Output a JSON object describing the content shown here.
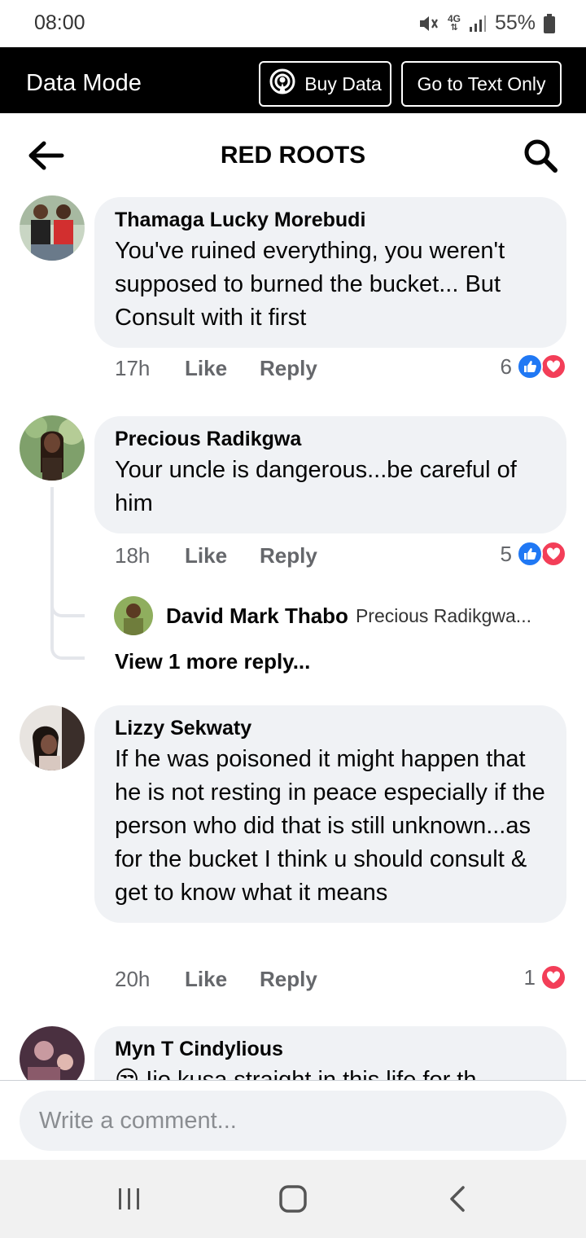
{
  "status_bar": {
    "time": "08:00",
    "network": "4G",
    "battery": "55%",
    "icons": [
      "mute-icon",
      "network-4g-icon",
      "signal-icon",
      "battery-icon"
    ]
  },
  "data_mode_bar": {
    "title": "Data Mode",
    "buy_data_label": "Buy Data",
    "text_only_label": "Go to Text Only"
  },
  "header": {
    "title": "RED ROOTS",
    "icons": [
      "back-arrow-icon",
      "search-icon"
    ]
  },
  "comments": [
    {
      "author": "Thamaga Lucky Morebudi",
      "text": "You've ruined everything, you weren't supposed to burned the bucket... But Consult with it first",
      "time": "17h",
      "like_label": "Like",
      "reply_label": "Reply",
      "reaction_count": "6",
      "reactions": [
        "like",
        "love"
      ]
    },
    {
      "author": "Precious Radikgwa",
      "text": "Your uncle is dangerous...be careful of him",
      "time": "18h",
      "like_label": "Like",
      "reply_label": "Reply",
      "reaction_count": "5",
      "reactions": [
        "like",
        "love"
      ],
      "reply_preview": {
        "author": "David Mark Thabo",
        "snippet": "Precious Radikgwa..."
      },
      "view_more": "View 1 more reply..."
    },
    {
      "author": "Lizzy Sekwaty",
      "text": "If he was poisoned it might happen that he is not resting in peace especially if the person who did that is still unknown...as for the bucket I think u should consult & get to know what it means",
      "time": "20h",
      "like_label": "Like",
      "reply_label": "Reply",
      "reaction_count": "1",
      "reactions": [
        "love"
      ]
    },
    {
      "author": "Myn T Cindylious",
      "text": "😒 Ijo kusa straight in this life for th"
    }
  ],
  "composer": {
    "placeholder": "Write a comment..."
  },
  "nav_bar": {
    "icons": [
      "recent-apps-icon",
      "home-icon",
      "nav-back-icon"
    ]
  },
  "colors": {
    "data_bar_bg": "#000000",
    "bubble_bg": "#f0f2f5",
    "like_blue": "#2078f4",
    "love_red": "#f33e58",
    "meta_gray": "#65676b"
  }
}
